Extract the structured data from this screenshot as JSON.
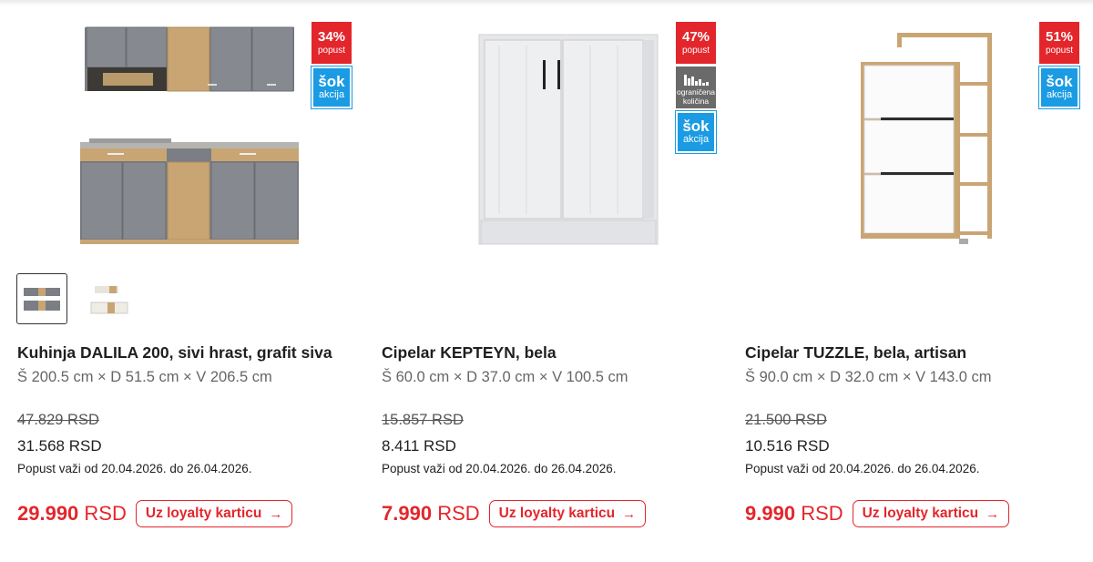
{
  "products": [
    {
      "title": "Kuhinja DALILA 200, sivi hrast, grafit siva",
      "dimensions": "Š 200.5 cm × D 51.5 cm × V 206.5 cm",
      "old_price": "47.829 RSD",
      "current_price": "31.568 RSD",
      "validity": "Popust važi od 20.04.2026. do 26.04.2026.",
      "loyalty_price_value": "29.990",
      "loyalty_price_currency": "RSD",
      "loyalty_button": "Uz loyalty karticu",
      "discount": {
        "pct": "34%",
        "label": "popust"
      },
      "sok": {
        "line1": "šok",
        "line2": "akcija"
      },
      "product_image_icon": "kitchen-set-icon"
    },
    {
      "title": "Cipelar KEPTEYN, bela",
      "dimensions": "Š 60.0 cm × D 37.0 cm × V 100.5 cm",
      "old_price": "15.857 RSD",
      "current_price": "8.411 RSD",
      "validity": "Popust važi od 20.04.2026. do 26.04.2026.",
      "loyalty_price_value": "7.990",
      "loyalty_price_currency": "RSD",
      "loyalty_button": "Uz loyalty karticu",
      "discount": {
        "pct": "47%",
        "label": "popust"
      },
      "limited": {
        "line1": "ograničena",
        "line2": "količina"
      },
      "sok": {
        "line1": "šok",
        "line2": "akcija"
      },
      "product_image_icon": "shoe-cabinet-icon"
    },
    {
      "title": "Cipelar TUZZLE, bela, artisan",
      "dimensions": "Š 90.0 cm × D 32.0 cm × V 143.0 cm",
      "old_price": "21.500 RSD",
      "current_price": "10.516 RSD",
      "validity": "Popust važi od 20.04.2026. do 26.04.2026.",
      "loyalty_price_value": "9.990",
      "loyalty_price_currency": "RSD",
      "loyalty_button": "Uz loyalty karticu",
      "discount": {
        "pct": "51%",
        "label": "popust"
      },
      "sok": {
        "line1": "šok",
        "line2": "akcija"
      },
      "product_image_icon": "shoe-rack-shelf-icon"
    }
  ],
  "thumbnails": {
    "count_for_first_product": 2,
    "selected_index": 0
  },
  "colors": {
    "accent_red": "#e3262b",
    "sok_blue": "#1a9be3",
    "limited_gray": "#6a6a6a",
    "text_dark": "#1f1f1f",
    "text_muted": "#666666"
  }
}
